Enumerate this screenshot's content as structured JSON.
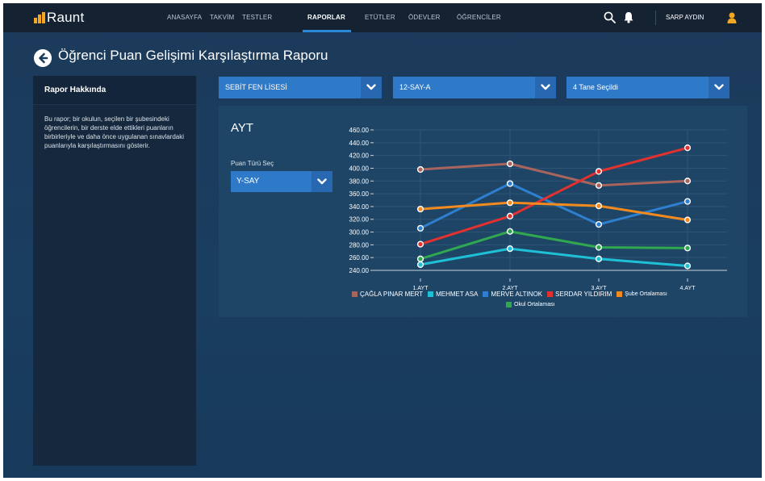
{
  "app": {
    "logo_text": "Raunt"
  },
  "nav": {
    "items": [
      {
        "label": "ANASAYFA"
      },
      {
        "label": "TAKVİM"
      },
      {
        "label": "TESTLER"
      },
      {
        "label": "RAPORLAR",
        "active": true
      },
      {
        "label": "ETÜTLER"
      },
      {
        "label": "ÖDEVLER"
      },
      {
        "label": "ÖĞRENCİLER"
      }
    ],
    "user_name": "SARP AYDIN",
    "search_icon": "search-icon",
    "bell_icon": "bell-icon",
    "user_icon": "user-icon"
  },
  "page": {
    "title": "Öğrenci Puan Gelişimi Karşılaştırma Raporu"
  },
  "sidebar": {
    "header": "Rapor Hakkında",
    "body": "Bu rapor; bir okulun, seçilen bir şubesindeki öğrencilerin, bir derste elde ettikleri puanların birbirleriyle ve daha önce uygulanan sınavlardaki puanlarıyla karşılaştırmasını gösterir."
  },
  "filters": {
    "school": "SEBİT FEN LİSESİ",
    "class": "12-SAY-A",
    "selection": "4 Tane Seçildi"
  },
  "panel": {
    "title": "AYT",
    "score_type_label": "Puan Türü Seç",
    "score_type_value": "Y-SAY"
  },
  "colors": {
    "accent": "#2f7ac8",
    "topbar": "#142232",
    "logo": "#f5a623"
  },
  "chart_data": {
    "type": "line",
    "categories": [
      "1.AYT",
      "2.AYT",
      "3.AYT",
      "4.AYT"
    ],
    "ylim": [
      240,
      460
    ],
    "yticks": [
      "240.00",
      "260.00",
      "280.00",
      "300.00",
      "320.00",
      "340.00",
      "360.00",
      "380.00",
      "400.00",
      "420.00",
      "440.00",
      "460.00"
    ],
    "grid": true,
    "legend_position": "bottom",
    "series": [
      {
        "name": "ÇAĞLA PINAR MERT",
        "color": "#a8655d",
        "values": [
          398,
          407,
          373,
          380
        ]
      },
      {
        "name": "MEHMET ASA",
        "color": "#1ec0d6",
        "values": [
          249,
          274,
          258,
          247
        ]
      },
      {
        "name": "MERVE ALTINOK",
        "color": "#2e7fd0",
        "values": [
          306,
          376,
          312,
          348
        ]
      },
      {
        "name": "SERDAR YILDIRIM",
        "color": "#e2312e",
        "values": [
          281,
          325,
          395,
          432
        ]
      },
      {
        "name": "Şube Ortalaması",
        "color": "#f28a1d",
        "values": [
          336,
          346,
          341,
          319
        ]
      },
      {
        "name": "Okul Ortalaması",
        "color": "#2fa84f",
        "values": [
          258,
          301,
          276,
          275
        ]
      }
    ]
  }
}
